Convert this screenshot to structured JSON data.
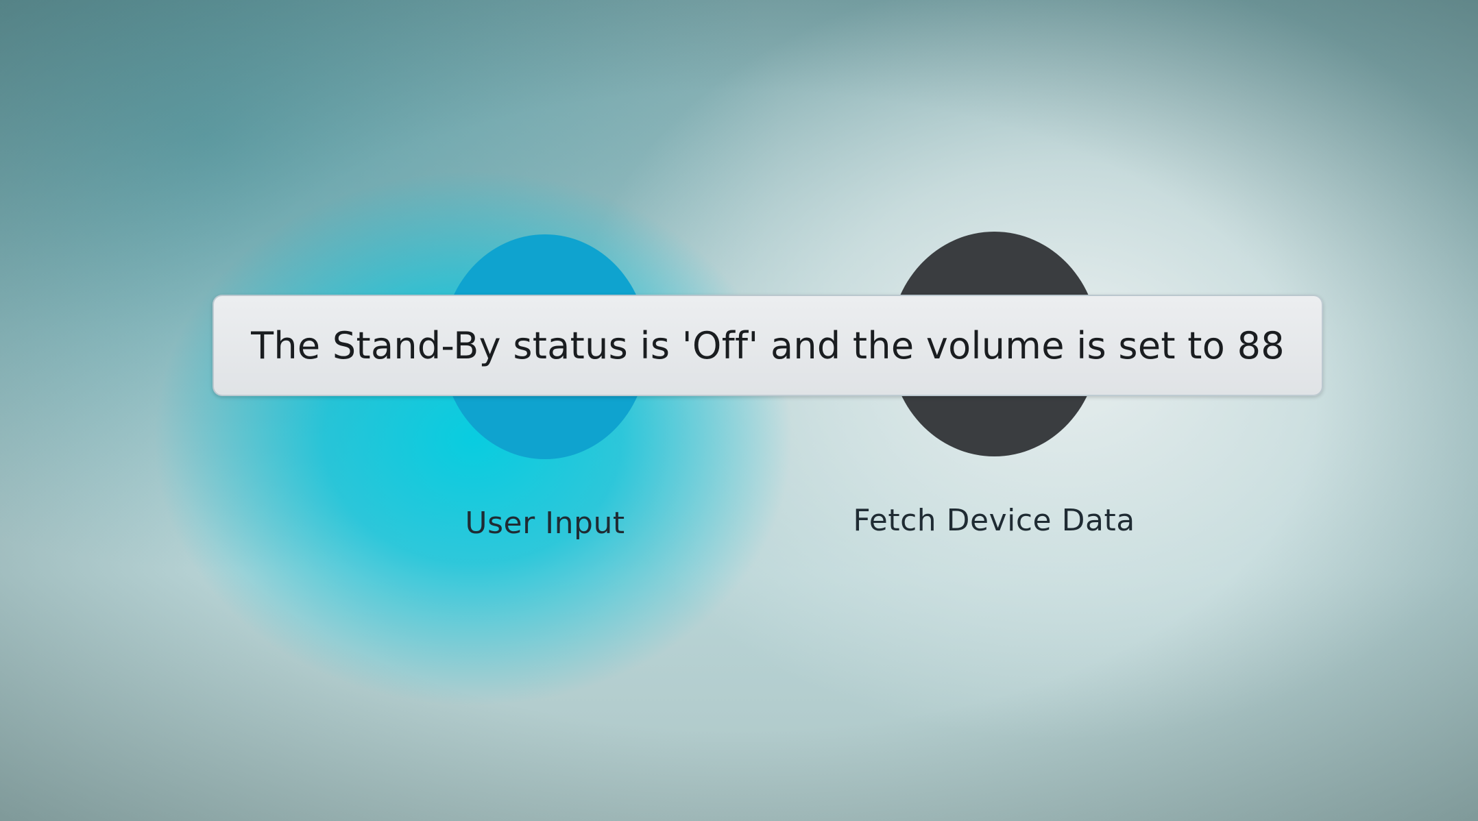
{
  "buttons": {
    "user_input": {
      "label": "User Input",
      "color": "#0fa3cf"
    },
    "fetch_device_data": {
      "label": "Fetch Device Data",
      "color": "#3a3d40"
    }
  },
  "toast": {
    "message": "The Stand-By status is 'Off' and the volume is set to 88"
  }
}
